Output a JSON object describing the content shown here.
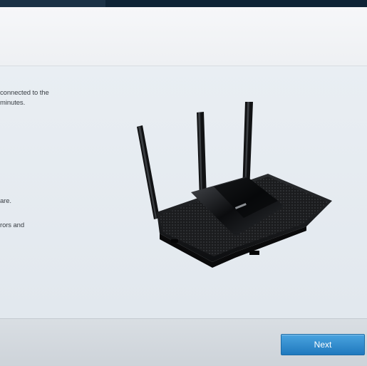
{
  "instructions": {
    "line_1": "connected to the",
    "line_2": "minutes.",
    "line_3": "are.",
    "line_4": "rors and"
  },
  "illustration": {
    "name": "router-illustration"
  },
  "footer": {
    "next_label": "Next"
  },
  "colors": {
    "accent": "#2b8fd4",
    "top_bar": "#0e2436"
  }
}
